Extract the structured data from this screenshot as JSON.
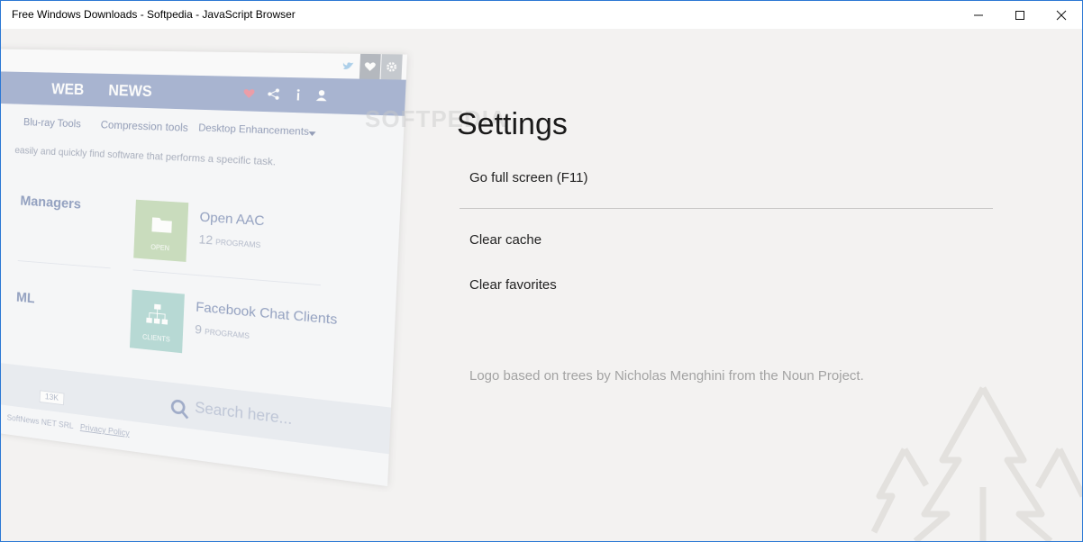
{
  "window": {
    "title": "Free Windows Downloads - Softpedia - JavaScript Browser"
  },
  "preview": {
    "nav": [
      "WEB",
      "NEWS"
    ],
    "categories": [
      "Blu-ray Tools",
      "Compression tools",
      "Desktop Enhancements"
    ],
    "description": "easily and quickly find software that performs a specific task.",
    "left_items": [
      "Managers",
      "ML"
    ],
    "items": [
      {
        "title": "Open AAC",
        "count": "12",
        "count_label": "PROGRAMS",
        "tile_label": "OPEN"
      },
      {
        "title": "Facebook Chat Clients",
        "count": "9",
        "count_label": "PROGRAMS",
        "tile_label": "CLIENTS"
      }
    ],
    "search_placeholder": "Search here...",
    "follow_count": "13K",
    "footer_company": "SoftNews NET SRL",
    "footer_link": "Privacy Policy"
  },
  "watermark": "SOFTPEDIA",
  "settings": {
    "title": "Settings",
    "items": [
      {
        "label": "Go full screen (F11)"
      },
      {
        "label": "Clear cache"
      },
      {
        "label": "Clear favorites"
      }
    ],
    "credit": "Logo based on trees by Nicholas Menghini from the Noun Project."
  },
  "colors": {
    "accent": "#2b78d4",
    "nav_bar": "#8a9bc3",
    "text_primary": "#1a1a1a",
    "text_muted": "#a3a3a3"
  },
  "icons": [
    "minimize-icon",
    "maximize-icon",
    "close-icon",
    "search-icon",
    "heart-icon",
    "share-icon",
    "info-icon",
    "user-icon",
    "gear-icon",
    "twitter-icon",
    "trees-logo-icon"
  ]
}
